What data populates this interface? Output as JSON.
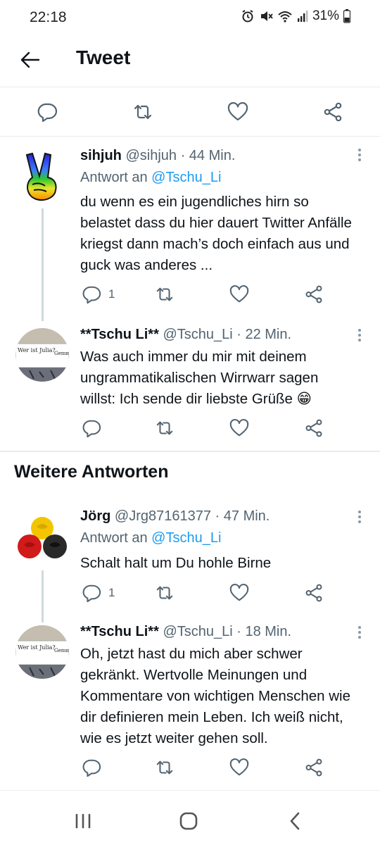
{
  "status_bar": {
    "time": "22:18",
    "battery_percent": "31%",
    "icons": [
      "alarm-icon",
      "mute-icon",
      "wifi-icon",
      "signal-icon",
      "battery-icon"
    ]
  },
  "header": {
    "back_icon": "arrow-left-icon",
    "title": "Tweet"
  },
  "main_actions": [
    "reply-icon",
    "retweet-icon",
    "like-icon",
    "share-icon"
  ],
  "tweets": [
    {
      "name": "sihjuh",
      "handle": "@sihjuh",
      "time": "· 44 Min.",
      "reply_prefix": "Antwort an",
      "reply_to": "@Tschu_Li",
      "text": "du wenn es ein jugendliches hirn so belastet dass du hier dauert Twitter Anfälle kriegst dann mach’s doch einfach aus und guck was anderes ...",
      "reply_count": "1"
    },
    {
      "name": "**Tschu Li**",
      "handle": "@Tschu_Li",
      "time": "· 22 Min.",
      "text": "Was auch immer du mir mit deinem ungrammatikalischen Wirrwarr sagen willst: Ich sende dir liebste Grüße",
      "emoji": "😁",
      "reply_count": ""
    }
  ],
  "section": {
    "title": "Weitere Antworten"
  },
  "more_tweets": [
    {
      "name": "Jörg",
      "handle": "@Jrg87161377",
      "time": "· 47 Min.",
      "reply_prefix": "Antwort an",
      "reply_to": "@Tschu_Li",
      "text": "Schalt halt um Du hohle Birne",
      "reply_count": "1"
    },
    {
      "name": "**Tschu Li**",
      "handle": "@Tschu_Li",
      "time": "· 18 Min.",
      "text": "Oh, jetzt hast du mich aber schwer gekränkt. Wertvolle Meinungen und Kommentare von wichtigen Menschen wie dir definieren mein Leben. Ich weiß nicht, wie es jetzt weiter gehen soll.",
      "reply_count": ""
    }
  ],
  "avatar_text": {
    "left": "Wer ist Julia?",
    "middle": "Bescheuerte",
    "right": "Gemma Julia?"
  },
  "nav_bar": [
    "recent-apps-icon",
    "home-icon",
    "back-icon"
  ],
  "colors": {
    "accent": "#1d9bf0",
    "text": "#0f1419",
    "muted": "#536471",
    "divider": "#e6ecf0"
  }
}
